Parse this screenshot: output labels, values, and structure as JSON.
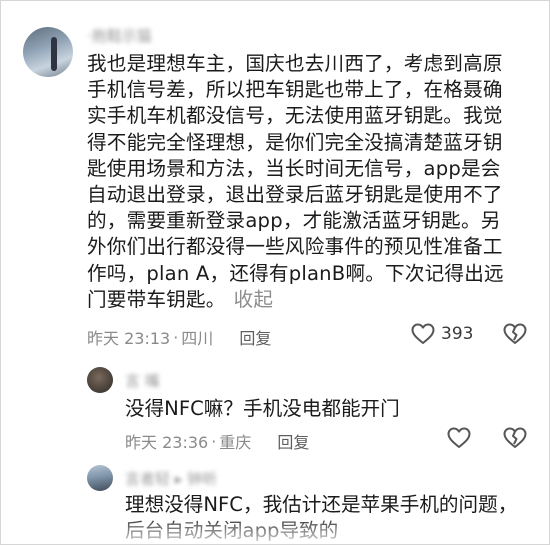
{
  "main_comment": {
    "username": "·抱鞋示猫",
    "text": "我也是理想车主，国庆也去川西了，考虑到高原手机信号差，所以把车钥匙也带上了，在格聂确实手机车机都没信号，无法使用蓝牙钥匙。我觉得不能完全怪理想，是你们完全没搞清楚蓝牙钥匙使用场景和方法，当长时间无信号，app是会自动退出登录，退出登录后蓝牙钥匙是使用不了的，需要重新登录app，才能激活蓝牙钥匙。另外你们出行都没得一些风险事件的预见性准备工作吗，plan A，还得有planB啊。下次记得出远门要带车钥匙。",
    "collapse_label": "收起",
    "time": "昨天 23:13",
    "location": "四川",
    "reply_label": "回复",
    "likes": "393",
    "icons": {
      "like": "heart-outline-icon",
      "dislike": "broken-heart-icon"
    }
  },
  "replies": [
    {
      "username": "言 嘴",
      "text": "没得NFC嘛？手机没电都能开门",
      "time": "昨天 23:36",
      "location": "重庆",
      "reply_label": "回复"
    },
    {
      "username": "言者轻 ▸ 钟听",
      "text": "理想没得NFC，我估计还是苹果手机的问题，后台自动关闭app导致的"
    }
  ],
  "separator": "·",
  "colors": {
    "text": "#1b1b1b",
    "meta": "#8a8a8a",
    "icon": "#555555"
  }
}
